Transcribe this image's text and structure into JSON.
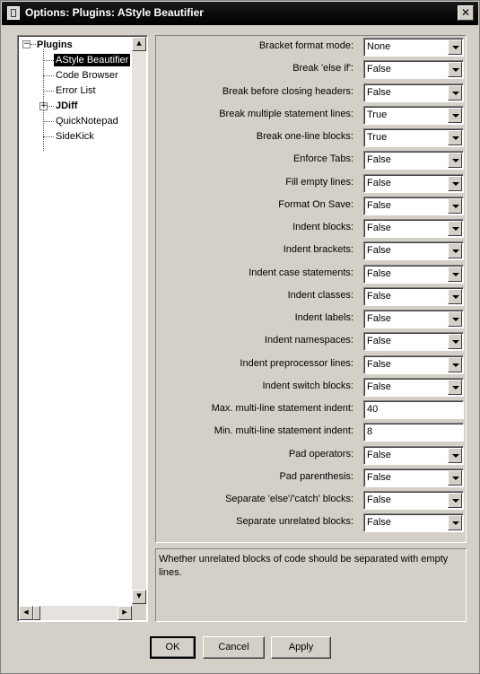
{
  "window": {
    "title": "Options: Plugins: AStyle Beautifier"
  },
  "tree": {
    "root": "Plugins",
    "items": [
      {
        "label": "AStyle Beautifier",
        "selected": true
      },
      {
        "label": "Code Browser"
      },
      {
        "label": "Error List"
      },
      {
        "label": "JDiff",
        "expandable": true
      },
      {
        "label": "QuickNotepad"
      },
      {
        "label": "SideKick"
      }
    ]
  },
  "options": [
    {
      "label": "Bracket format mode:",
      "value": "None",
      "type": "combo"
    },
    {
      "label": "Break 'else if':",
      "value": "False",
      "type": "combo"
    },
    {
      "label": "Break before closing headers:",
      "value": "False",
      "type": "combo"
    },
    {
      "label": "Break multiple statement lines:",
      "value": "True",
      "type": "combo"
    },
    {
      "label": "Break one-line blocks:",
      "value": "True",
      "type": "combo"
    },
    {
      "label": "Enforce Tabs:",
      "value": "False",
      "type": "combo"
    },
    {
      "label": "Fill empty lines:",
      "value": "False",
      "type": "combo"
    },
    {
      "label": "Format On Save:",
      "value": "False",
      "type": "combo"
    },
    {
      "label": "Indent blocks:",
      "value": "False",
      "type": "combo"
    },
    {
      "label": "Indent brackets:",
      "value": "False",
      "type": "combo"
    },
    {
      "label": "Indent case statements:",
      "value": "False",
      "type": "combo"
    },
    {
      "label": "Indent classes:",
      "value": "False",
      "type": "combo"
    },
    {
      "label": "Indent labels:",
      "value": "False",
      "type": "combo"
    },
    {
      "label": "Indent namespaces:",
      "value": "False",
      "type": "combo"
    },
    {
      "label": "Indent preprocessor lines:",
      "value": "False",
      "type": "combo"
    },
    {
      "label": "Indent switch blocks:",
      "value": "False",
      "type": "combo"
    },
    {
      "label": "Max. multi-line statement indent:",
      "value": "40",
      "type": "text"
    },
    {
      "label": "Min. multi-line statement indent:",
      "value": "8",
      "type": "text"
    },
    {
      "label": "Pad operators:",
      "value": "False",
      "type": "combo"
    },
    {
      "label": "Pad parenthesis:",
      "value": "False",
      "type": "combo"
    },
    {
      "label": "Separate 'else'/'catch' blocks:",
      "value": "False",
      "type": "combo"
    },
    {
      "label": "Separate unrelated blocks:",
      "value": "False",
      "type": "combo"
    }
  ],
  "description": "Whether unrelated blocks of code should be separated with empty lines.",
  "buttons": {
    "ok": "OK",
    "cancel": "Cancel",
    "apply": "Apply"
  }
}
